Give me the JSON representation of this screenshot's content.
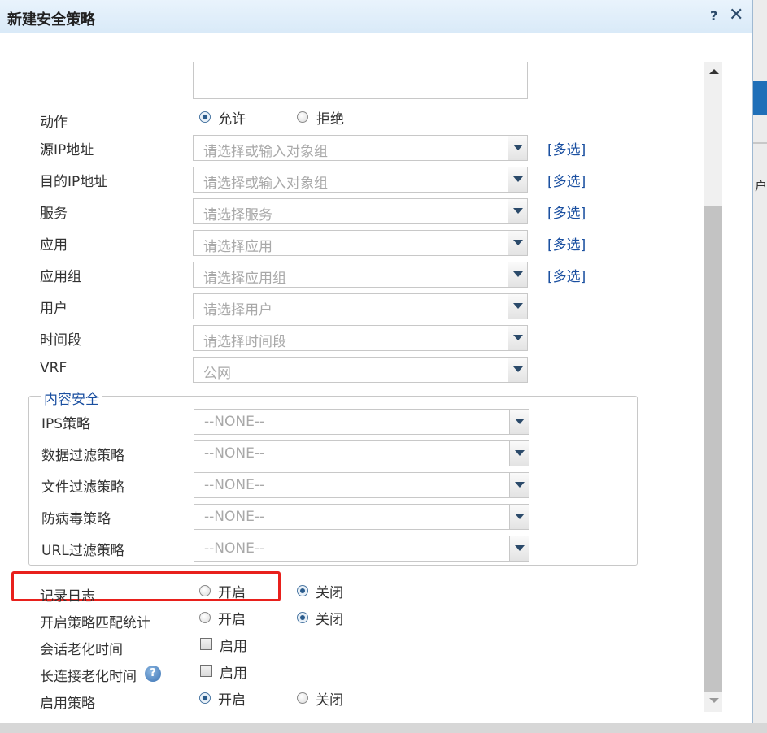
{
  "dialog": {
    "title": "新建安全策略",
    "help_label": "?",
    "close_label": "✕"
  },
  "background": {
    "fragment": "户"
  },
  "action": {
    "label": "动作",
    "options": [
      "允许",
      "拒绝"
    ],
    "selected": "允许"
  },
  "fields": [
    {
      "label": "源IP地址",
      "placeholder": "请选择或输入对象组",
      "multi": "[多选]"
    },
    {
      "label": "目的IP地址",
      "placeholder": "请选择或输入对象组",
      "multi": "[多选]"
    },
    {
      "label": "服务",
      "placeholder": "请选择服务",
      "multi": "[多选]"
    },
    {
      "label": "应用",
      "placeholder": "请选择应用",
      "multi": "[多选]"
    },
    {
      "label": "应用组",
      "placeholder": "请选择应用组",
      "multi": "[多选]"
    },
    {
      "label": "用户",
      "placeholder": "请选择用户"
    },
    {
      "label": "时间段",
      "placeholder": "请选择时间段"
    },
    {
      "label": "VRF",
      "placeholder": "公网"
    }
  ],
  "content_security": {
    "legend": "内容安全",
    "fields": [
      {
        "label": "IPS策略",
        "value": "--NONE--"
      },
      {
        "label": "数据过滤策略",
        "value": "--NONE--"
      },
      {
        "label": "文件过滤策略",
        "value": "--NONE--"
      },
      {
        "label": "防病毒策略",
        "value": "--NONE--"
      },
      {
        "label": "URL过滤策略",
        "value": "--NONE--"
      }
    ]
  },
  "log": {
    "label": "记录日志",
    "options": [
      "开启",
      "关闭"
    ],
    "selected": "关闭"
  },
  "match_stats": {
    "label": "开启策略匹配统计",
    "options": [
      "开启",
      "关闭"
    ],
    "selected": "关闭"
  },
  "session_aging": {
    "label": "会话老化时间",
    "checkbox_label": "启用",
    "checked": false
  },
  "long_conn_aging": {
    "label": "长连接老化时间",
    "checkbox_label": "启用",
    "checked": false,
    "help_icon": "?"
  },
  "enable_policy": {
    "label": "启用策略",
    "options": [
      "开启",
      "关闭"
    ],
    "selected": "开启"
  },
  "colors": {
    "accent": "#1a4fa0",
    "highlight": "#e8201c",
    "titlebar": "#dbeaf8"
  }
}
